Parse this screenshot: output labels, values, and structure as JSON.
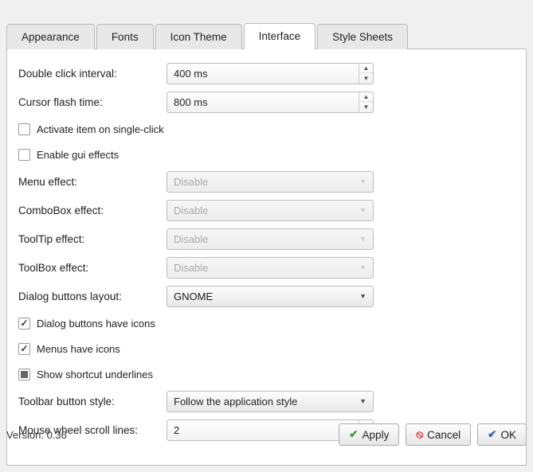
{
  "tabs": {
    "appearance": "Appearance",
    "fonts": "Fonts",
    "icon_theme": "Icon Theme",
    "interface": "Interface",
    "style_sheets": "Style Sheets"
  },
  "form": {
    "double_click_label": "Double click interval:",
    "double_click_value": "400 ms",
    "cursor_flash_label": "Cursor flash time:",
    "cursor_flash_value": "800 ms",
    "activate_single_click": "Activate item on single-click",
    "enable_gui_effects": "Enable gui effects",
    "menu_effect_label": "Menu effect:",
    "menu_effect_value": "Disable",
    "combobox_effect_label": "ComboBox effect:",
    "combobox_effect_value": "Disable",
    "tooltip_effect_label": "ToolTip effect:",
    "tooltip_effect_value": "Disable",
    "toolbox_effect_label": "ToolBox effect:",
    "toolbox_effect_value": "Disable",
    "dialog_layout_label": "Dialog buttons layout:",
    "dialog_layout_value": "GNOME",
    "dialog_buttons_icons": "Dialog buttons have icons",
    "menus_have_icons": "Menus have icons",
    "show_shortcut_underlines": "Show shortcut underlines",
    "toolbar_style_label": "Toolbar button style:",
    "toolbar_style_value": "Follow the application style",
    "mouse_wheel_label": "Mouse wheel scroll lines:",
    "mouse_wheel_value": "2"
  },
  "footer": {
    "version": "Version: 0.36",
    "apply": "Apply",
    "cancel": "Cancel",
    "ok": "OK"
  }
}
